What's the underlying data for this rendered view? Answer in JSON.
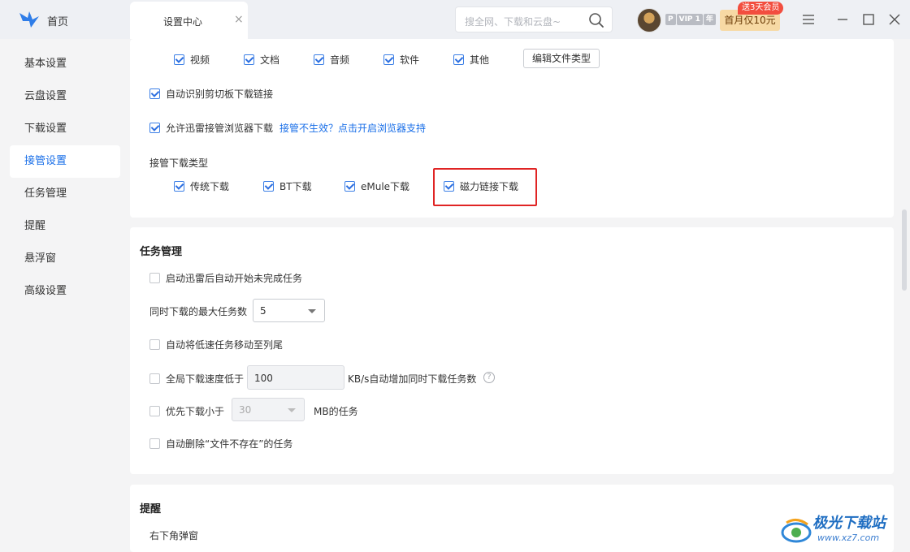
{
  "titlebar": {
    "home_label": "首页",
    "tab_label": "设置中心",
    "tab_close": "×",
    "search_placeholder": "搜全网、下载和云盘~",
    "vip_p": "P",
    "vip_label": "VIP 1",
    "vip_year": "年",
    "promo_label": "首月仅10元",
    "promo_tag": "送3天会员"
  },
  "sidebar": {
    "items": [
      {
        "label": "基本设置"
      },
      {
        "label": "云盘设置"
      },
      {
        "label": "下载设置"
      },
      {
        "label": "接管设置",
        "active": true
      },
      {
        "label": "任务管理"
      },
      {
        "label": "提醒"
      },
      {
        "label": "悬浮窗"
      },
      {
        "label": "高级设置"
      }
    ]
  },
  "takeover": {
    "file_types": [
      {
        "label": "视频",
        "checked": true
      },
      {
        "label": "文档",
        "checked": true
      },
      {
        "label": "音频",
        "checked": true
      },
      {
        "label": "软件",
        "checked": true
      },
      {
        "label": "其他",
        "checked": true
      }
    ],
    "edit_file_types_button": "编辑文件类型",
    "clipboard_label": "自动识别剪切板下载链接",
    "browser_label": "允许迅雷接管浏览器下载",
    "browser_link": "接管不生效？点击开启浏览器支持",
    "download_types_title": "接管下载类型",
    "download_types": [
      {
        "label": "传统下载",
        "checked": true
      },
      {
        "label": "BT下载",
        "checked": true
      },
      {
        "label": "eMule下载",
        "checked": true
      },
      {
        "label": "磁力链接下载",
        "checked": true
      }
    ]
  },
  "task": {
    "title": "任务管理",
    "auto_start_label": "启动迅雷后自动开始未完成任务",
    "max_tasks_label": "同时下载的最大任务数",
    "max_tasks_value": "5",
    "move_slow_label": "自动将低速任务移动至列尾",
    "speed_label": "全局下载速度低于",
    "speed_value": "100",
    "speed_suffix": "KB/s自动增加同时下载任务数",
    "help": "?",
    "priority_label": "优先下载小于",
    "priority_value": "30",
    "priority_suffix": "MB的任务",
    "delete_missing_label": "自动删除“文件不存在”的任务"
  },
  "remind": {
    "title": "提醒",
    "popup_label": "右下角弹窗"
  },
  "watermark": {
    "title": "极光下载站",
    "url": "www.xz7.com"
  }
}
